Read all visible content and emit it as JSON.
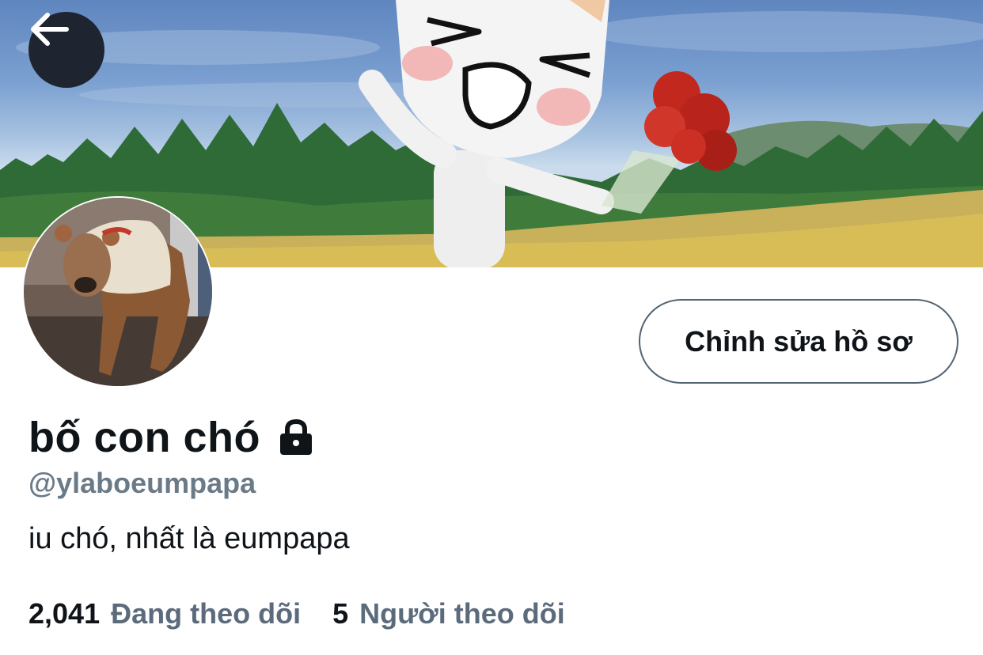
{
  "profile": {
    "display_name": "bố con chó",
    "handle": "@ylaboeumpapa",
    "bio": "iu chó, nhất là eumpapa",
    "protected_icon": "lock-icon"
  },
  "actions": {
    "back_icon": "arrow-left-icon",
    "edit_profile_label": "Chỉnh sửa hồ sơ"
  },
  "stats": {
    "following_count": "2,041",
    "following_label": "Đang theo dõi",
    "followers_count": "5",
    "followers_label": "Người theo dõi"
  },
  "colors": {
    "text_primary": "#0f1419",
    "text_secondary": "#5b6b7c",
    "button_border": "#536471",
    "back_button_bg": "#1f2530"
  }
}
